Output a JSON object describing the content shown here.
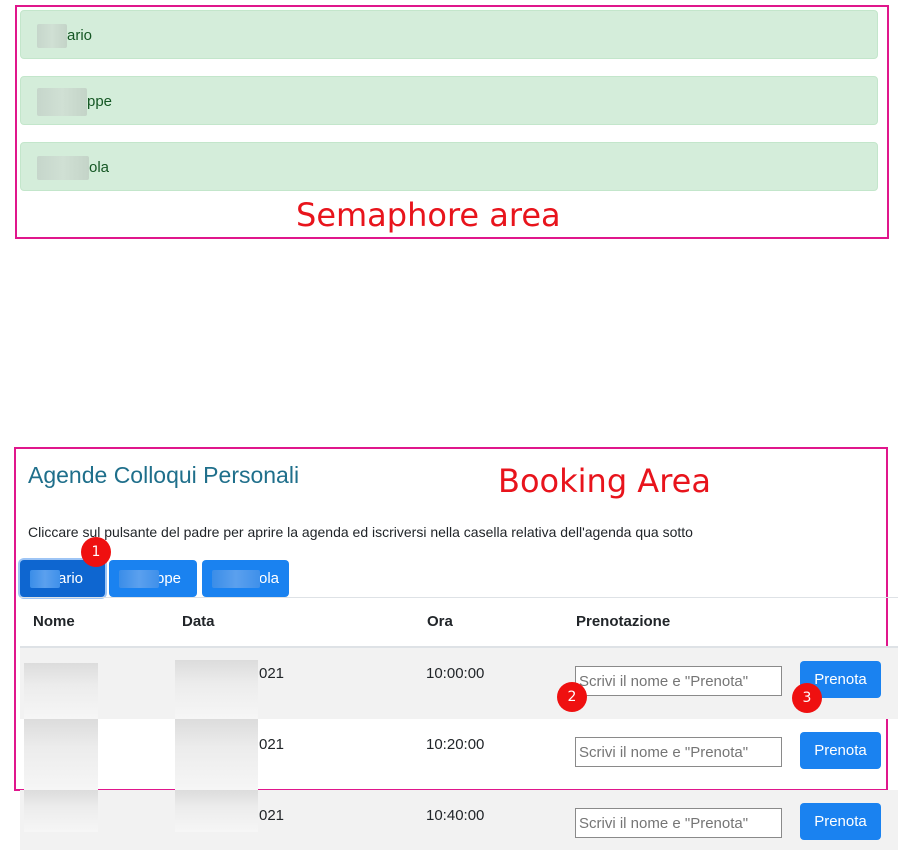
{
  "semaphore": {
    "rows": [
      {
        "suffix": "ario"
      },
      {
        "suffix": "ppe"
      },
      {
        "suffix": "ola"
      }
    ]
  },
  "annotations": {
    "semaphore_label": "Semaphore area",
    "booking_label": "Booking Area",
    "badges": [
      "1",
      "2",
      "3"
    ]
  },
  "booking": {
    "title": "Agende Colloqui Personali",
    "instructions": "Cliccare sul pulsante del padre per aprire la agenda ed iscriversi nella casella relativa dell'agenda qua sotto",
    "tabs": [
      {
        "label": "ario"
      },
      {
        "label": "ppe"
      },
      {
        "label": "ola"
      }
    ],
    "table": {
      "headers": {
        "nome": "Nome",
        "data": "Data",
        "ora": "Ora",
        "prenotazione": "Prenotazione"
      },
      "rows": [
        {
          "data": "021",
          "ora": "10:00:00",
          "placeholder": "Scrivi il nome e \"Prenota\"",
          "button": "Prenota"
        },
        {
          "data": "021",
          "ora": "10:20:00",
          "placeholder": "Scrivi il nome e \"Prenota\"",
          "button": "Prenota"
        },
        {
          "data": "021",
          "ora": "10:40:00",
          "placeholder": "Scrivi il nome e \"Prenota\"",
          "button": "Prenota"
        }
      ]
    }
  },
  "colors": {
    "annotation_border": "#e0168c",
    "annotation_text": "#e8141c",
    "success_bg": "#d4edda",
    "primary": "#1a82f0",
    "title": "#1f6f8b"
  }
}
